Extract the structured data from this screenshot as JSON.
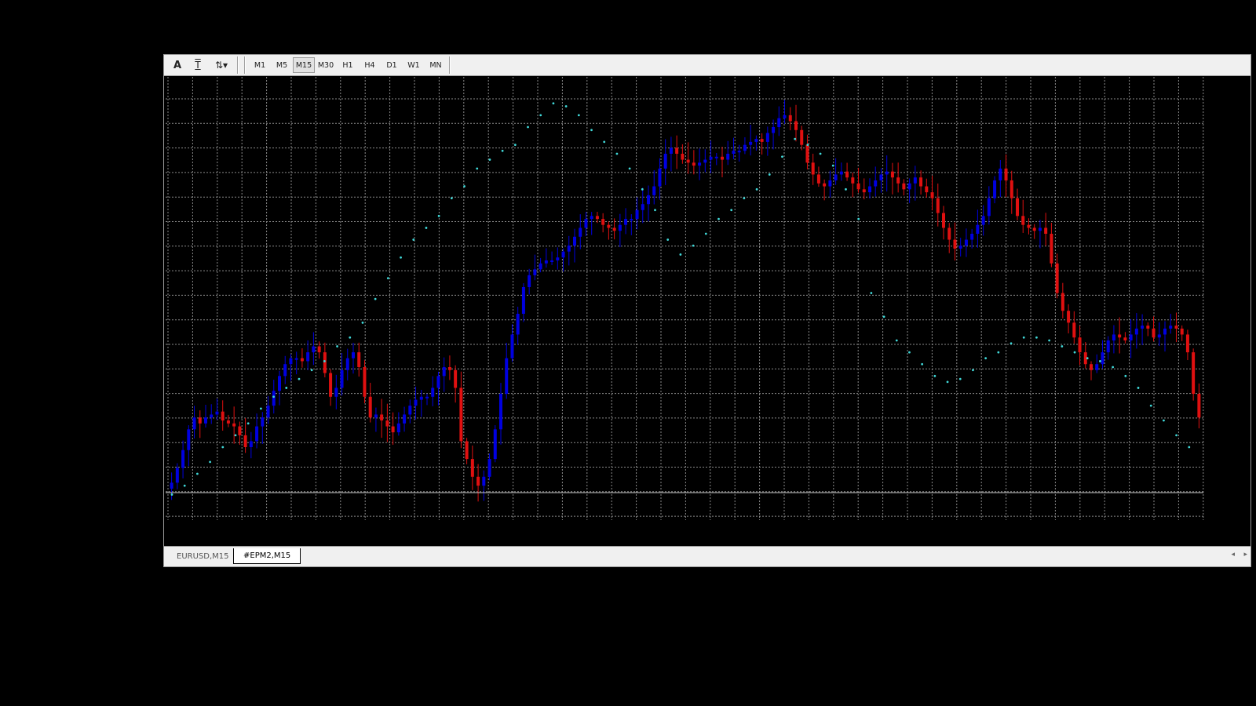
{
  "toolbar": {
    "icons": [
      {
        "name": "text-tool-icon",
        "glyph": "A"
      },
      {
        "name": "text-label-tool-icon",
        "glyph": "T"
      },
      {
        "name": "arrows-dropdown-icon",
        "glyph": "⇅▾"
      }
    ],
    "timeframes": [
      "M1",
      "M5",
      "M15",
      "M30",
      "H1",
      "H4",
      "D1",
      "W1",
      "MN"
    ],
    "active_timeframe": "M15"
  },
  "tabs": [
    {
      "label": "EURUSD,M15",
      "active": false
    },
    {
      "label": "#EPM2,M15",
      "active": true
    }
  ],
  "scroll": {
    "left": "◂",
    "right": "▸"
  },
  "colors": {
    "bull": "#0000e0",
    "bear": "#e01010",
    "sar": "#40d8d8",
    "grid": "#8a8a8a",
    "background": "#000000"
  },
  "chart_data": {
    "type": "candlestick",
    "closes": [
      0.06,
      0.11,
      0.17,
      0.24,
      0.28,
      0.26,
      0.28,
      0.29,
      0.3,
      0.27,
      0.26,
      0.25,
      0.22,
      0.18,
      0.2,
      0.25,
      0.28,
      0.32,
      0.37,
      0.42,
      0.46,
      0.48,
      0.48,
      0.47,
      0.5,
      0.52,
      0.5,
      0.43,
      0.35,
      0.38,
      0.44,
      0.48,
      0.5,
      0.45,
      0.35,
      0.28,
      0.29,
      0.27,
      0.25,
      0.23,
      0.26,
      0.29,
      0.32,
      0.34,
      0.35,
      0.35,
      0.38,
      0.42,
      0.45,
      0.44,
      0.38,
      0.2,
      0.14,
      0.08,
      0.05,
      0.08,
      0.14,
      0.24,
      0.36,
      0.48,
      0.56,
      0.63,
      0.72,
      0.76,
      0.78,
      0.8,
      0.81,
      0.81,
      0.82,
      0.84,
      0.86,
      0.89,
      0.92,
      0.95,
      0.96,
      0.95,
      0.93,
      0.92,
      0.91,
      0.93,
      0.95,
      0.95,
      0.98,
      1.0,
      1.03,
      1.06,
      1.12,
      1.17,
      1.19,
      1.17,
      1.15,
      1.14,
      1.13,
      1.14,
      1.15,
      1.16,
      1.16,
      1.15,
      1.17,
      1.18,
      1.18,
      1.2,
      1.21,
      1.22,
      1.21,
      1.24,
      1.26,
      1.29,
      1.3,
      1.28,
      1.25,
      1.2,
      1.14,
      1.1,
      1.07,
      1.06,
      1.08,
      1.1,
      1.11,
      1.09,
      1.07,
      1.05,
      1.04,
      1.06,
      1.08,
      1.1,
      1.11,
      1.09,
      1.07,
      1.05,
      1.07,
      1.09,
      1.06,
      1.04,
      1.02,
      0.97,
      0.92,
      0.88,
      0.85,
      0.86,
      0.88,
      0.9,
      0.93,
      0.96,
      1.02,
      1.08,
      1.12,
      1.08,
      1.02,
      0.96,
      0.93,
      0.92,
      0.91,
      0.92,
      0.9,
      0.8,
      0.7,
      0.64,
      0.6,
      0.55,
      0.5,
      0.46,
      0.44,
      0.46,
      0.5,
      0.54,
      0.56,
      0.55,
      0.54,
      0.56,
      0.58,
      0.59,
      0.58,
      0.55,
      0.56,
      0.58,
      0.59,
      0.58,
      0.56,
      0.5,
      0.36,
      0.28
    ],
    "sar": [
      0.02,
      0.05,
      0.09,
      0.13,
      0.18,
      0.22,
      0.26,
      0.31,
      0.35,
      0.38,
      0.41,
      0.44,
      0.47,
      0.52,
      0.55,
      0.6,
      0.68,
      0.75,
      0.82,
      0.88,
      0.92,
      0.96,
      1.02,
      1.06,
      1.12,
      1.15,
      1.18,
      1.2,
      1.26,
      1.3,
      1.34,
      1.33,
      1.3,
      1.25,
      1.21,
      1.17,
      1.12,
      1.05,
      0.98,
      0.88,
      0.83,
      0.86,
      0.9,
      0.95,
      0.98,
      1.02,
      1.05,
      1.1,
      1.16,
      1.22,
      1.2,
      1.17,
      1.13,
      1.05,
      0.95,
      0.7,
      0.62,
      0.54,
      0.5,
      0.46,
      0.42,
      0.4,
      0.41,
      0.44,
      0.48,
      0.5,
      0.53,
      0.55,
      0.55,
      0.54,
      0.52,
      0.5,
      0.48,
      0.47,
      0.45,
      0.42,
      0.38,
      0.32,
      0.27,
      0.22,
      0.18
    ],
    "ylim": [
      0,
      1.35
    ]
  }
}
